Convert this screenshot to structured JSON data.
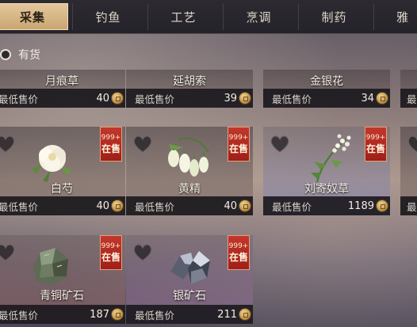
{
  "tabs": [
    {
      "label": "采集",
      "active": true
    },
    {
      "label": "钓鱼",
      "active": false
    },
    {
      "label": "工艺",
      "active": false
    },
    {
      "label": "烹调",
      "active": false
    },
    {
      "label": "制药",
      "active": false
    },
    {
      "label": "雅",
      "active": false
    }
  ],
  "filter": {
    "label": "有货",
    "checked": false
  },
  "price_label": "最低售价",
  "badge": {
    "count": "999+",
    "status": "在售"
  },
  "items_row1": [
    {
      "name": "月痕草",
      "price": "40"
    },
    {
      "name": "延胡索",
      "price": "39"
    },
    {
      "name": "金银花",
      "price": "34"
    }
  ],
  "items_row2": [
    {
      "name": "白芍",
      "price": "40",
      "icon": "white-peony-icon"
    },
    {
      "name": "黄精",
      "price": "40",
      "icon": "huangjing-flower-icon"
    },
    {
      "name": "刘寄奴草",
      "price": "1189",
      "icon": "liujinu-herb-icon"
    }
  ],
  "items_row3": [
    {
      "name": "青铜矿石",
      "price": "187",
      "icon": "bronze-ore-icon"
    },
    {
      "name": "银矿石",
      "price": "211",
      "icon": "silver-ore-icon"
    }
  ],
  "partial_column": {
    "price_label_fragment": "最"
  }
}
